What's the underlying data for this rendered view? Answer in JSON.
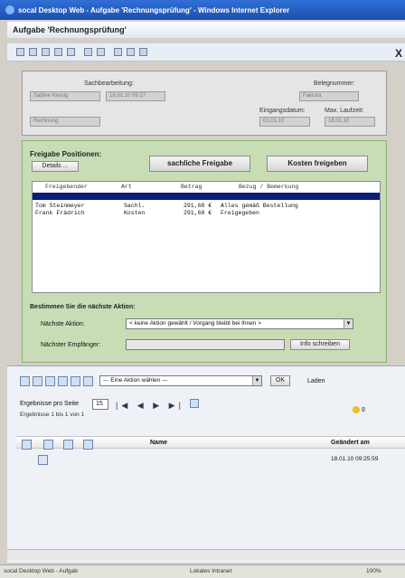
{
  "window": {
    "title": "socal Desktop Web - Aufgabe 'Rechnungsprüfung' - Windows Internet Explorer",
    "header": "Aufgabe 'Rechnungsprüfung'",
    "close_glyph": "X"
  },
  "form": {
    "sachbearbeitung_label": "Sachbearbeitung:",
    "sachbearbeitung_value_1": "Sabine Kessig",
    "sachbearbeitung_value_2": "18.01.10 09:27",
    "belegnummer_label": "Belegnummer:",
    "belegnummer_value": "Faktura",
    "eingangsdatum_label": "Eingangsdatum:",
    "max_laufzeit_label": "Max. Laufzeit:",
    "eingangsdatum_value": "01.01.10",
    "max_laufzeit_value": "18.01.10",
    "extra_value": "Rechnung"
  },
  "freigabe": {
    "title": "Freigabe Positionen:",
    "detail_button": "Details ...",
    "sachlich_button": "sachliche Freigabe",
    "kosten_button": "Kosten freigeben",
    "columns": [
      "Freigebender",
      "Art",
      "Betrag",
      "Bezug / Bemerkung"
    ],
    "rows": [
      {
        "name": "Tom Steinmeyer",
        "art": "Sachl.",
        "betrag": "291,68 €",
        "bemerkung": "Alles gemäß Bestellung"
      },
      {
        "name": "Frank Frädrich",
        "art": "Kosten",
        "betrag": "291,68 €",
        "bemerkung": "Freigegeben"
      }
    ]
  },
  "next_action": {
    "title": "Bestimmen Sie die nächste Aktion:",
    "naechste_label": "Nächste Aktion:",
    "naechste_value": "< keine Aktion gewählt / Vorgang bleibt bei Ihnen >",
    "empfaenger_label": "Nächster Empfänger:",
    "empfaenger_button": "Info schreiben"
  },
  "lower": {
    "action_select": "--- Eine Aktion wählen ---",
    "ok_button": "OK",
    "extra_label": "Laden",
    "results_per_page_label": "Ergebnisse pro Seite",
    "results_per_page_value": "15",
    "results_summary": "Ergebnisse 1 bis 1 von 1",
    "column_name": "Name",
    "column_modified": "Geändert am",
    "row_modified": "18.01.10 09:25:59",
    "badge": "0"
  },
  "status": {
    "left": "socal Desktop Web - Aufgab",
    "zone": "Lokales Intranet",
    "zoom": "100%"
  }
}
